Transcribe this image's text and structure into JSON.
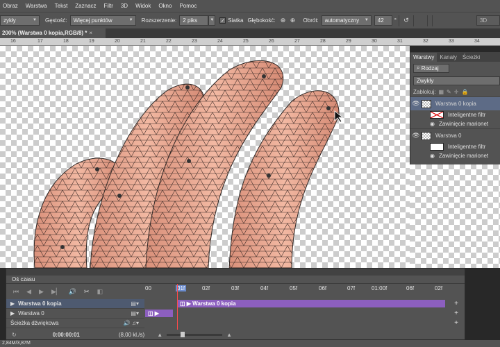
{
  "menu": [
    "Obraz",
    "Warstwa",
    "Tekst",
    "Zaznacz",
    "Filtr",
    "3D",
    "Widok",
    "Okno",
    "Pomoc"
  ],
  "options": {
    "mode_value": "zykły",
    "density_label": "Gęstość:",
    "density_value": "Więcej punktów",
    "expansion_label": "Rozszerzenie:",
    "expansion_value": "2 piks",
    "mesh_label": "Siatka",
    "depth_label": "Głębokość:",
    "rotate_label": "Obrót:",
    "rotate_value": "automatyczny",
    "angle_value": "42",
    "degree_symbol": "°",
    "mode3d": "3D"
  },
  "document_tab": {
    "title": "200% (Warstwa 0 kopia,RGB/8) *",
    "close": "×"
  },
  "ruler_ticks": [
    "16",
    "17",
    "18",
    "19",
    "20",
    "21",
    "22",
    "23",
    "24",
    "25",
    "26",
    "27",
    "28",
    "29",
    "30",
    "31",
    "32",
    "33",
    "34"
  ],
  "layers_panel": {
    "tabs": [
      "Warstwy",
      "Kanały",
      "Ścieżki"
    ],
    "kind_value": "Rodzaj",
    "blend_value": "Zwykły",
    "lock_label": "Zablokuj:",
    "layers": [
      {
        "name": "Warstwa 0 kopia",
        "filter_label": "Inteligentne filtr",
        "warp_label": "Zawinięcie marionet"
      },
      {
        "name": "Warstwa 0",
        "filter_label": "Inteligentne filtr",
        "warp_label": "Zawinięcie marionet"
      }
    ]
  },
  "timeline": {
    "title": "Oś czasu",
    "ruler": [
      "00",
      "02f",
      "03f",
      "04f",
      "05f",
      "06f",
      "07f",
      "01:00f",
      "02f"
    ],
    "playhead_label": "01f",
    "tracks": [
      {
        "name": "Warstwa 0 kopia",
        "clip": "Warstwa 0 kopia"
      },
      {
        "name": "Warstwa 0"
      },
      {
        "name": "Ścieżka dźwiękowa"
      }
    ],
    "timecode": "0:00:00:01",
    "fps": "(8,00 kl./s)"
  },
  "status": {
    "doc_size": "2,84M/3,87M"
  },
  "colors": {
    "panel": "#535353",
    "selection": "#5d6b86",
    "clip": "#8c5fbf",
    "playhead": "#ff4a4a"
  }
}
